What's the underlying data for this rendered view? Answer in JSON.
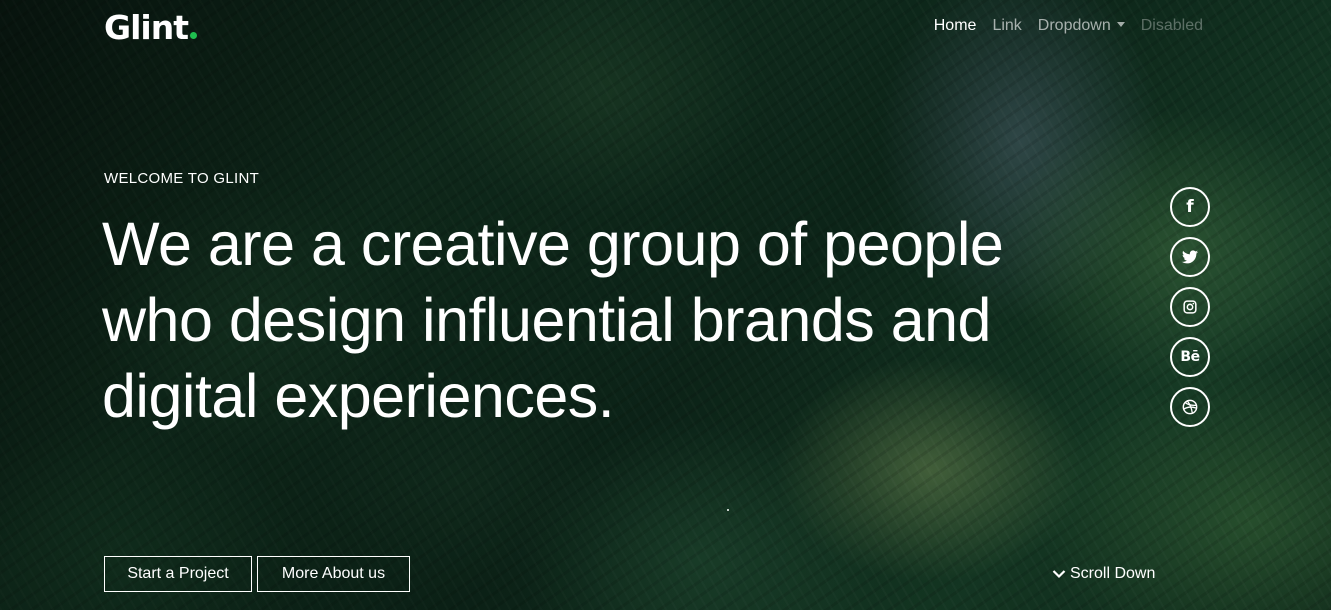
{
  "brand": {
    "name": "Glint",
    "dot_color": "#1fbf4f"
  },
  "nav": {
    "items": [
      {
        "label": "Home",
        "state": "active"
      },
      {
        "label": "Link",
        "state": "normal"
      },
      {
        "label": "Dropdown",
        "state": "normal"
      },
      {
        "label": "Disabled",
        "state": "disabled"
      }
    ]
  },
  "hero": {
    "eyebrow": "WELCOME TO GLINT",
    "headline_lines": [
      "We are a creative group of people",
      "who design influential brands and",
      "digital experiences."
    ],
    "primary_button": "Start a Project",
    "secondary_button": "More About us",
    "scroll_label": "Scroll Down"
  },
  "social": [
    {
      "icon": "facebook-icon",
      "glyph": "f"
    },
    {
      "icon": "twitter-icon"
    },
    {
      "icon": "instagram-icon"
    },
    {
      "icon": "behance-icon",
      "glyph": "Bē"
    },
    {
      "icon": "dribbble-icon"
    }
  ]
}
